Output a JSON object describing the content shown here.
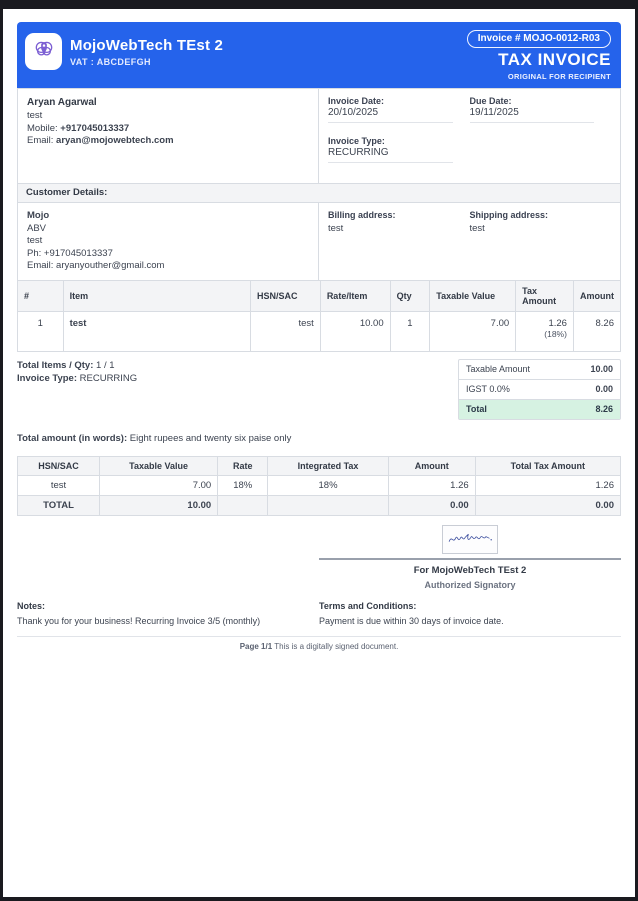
{
  "header": {
    "company_name": "MojoWebTech TEst 2",
    "vat_line": "VAT : ABCDEFGH",
    "invoice_number_badge": "Invoice # MOJO-0012-R03",
    "doc_title": "TAX INVOICE",
    "doc_subtitle": "ORIGINAL FOR RECIPIENT",
    "accent_color": "#2563eb",
    "logo_icon": "brain-icon"
  },
  "seller": {
    "name": "Aryan Agarwal",
    "line2": "test",
    "mobile_label": "Mobile: ",
    "mobile_value": "+917045013337",
    "email_label": "Email: ",
    "email_value": "aryan@mojowebtech.com"
  },
  "invoice_meta": {
    "invoice_date_label": "Invoice Date:",
    "invoice_date": "20/10/2025",
    "due_date_label": "Due Date:",
    "due_date": "19/11/2025",
    "invoice_type_label": "Invoice Type:",
    "invoice_type": "RECURRING"
  },
  "customer": {
    "section_title": "Customer Details:",
    "name": "Mojo",
    "line2": "ABV",
    "line3": "test",
    "phone_line": "Ph: +917045013337",
    "email_line": "Email: aryanyouther@gmail.com",
    "billing_label": "Billing address:",
    "billing_value": "test",
    "shipping_label": "Shipping address:",
    "shipping_value": "test"
  },
  "items_table": {
    "headers": [
      "#",
      "Item",
      "HSN/SAC",
      "Rate/Item",
      "Qty",
      "Taxable Value",
      "Tax Amount",
      "Amount"
    ],
    "rows": [
      {
        "sno": "1",
        "item": "test",
        "hsn": "test",
        "rate": "10.00",
        "qty": "1",
        "taxable_value": "7.00",
        "tax_amount": "1.26",
        "tax_rate_note": "(18%)",
        "amount": "8.26"
      }
    ]
  },
  "totals": {
    "items_qty_label": "Total Items / Qty: ",
    "items_qty_value": "1 / 1",
    "invoice_type_label": "Invoice Type: ",
    "invoice_type_value": "RECURRING",
    "rows": [
      {
        "label": "Taxable Amount",
        "value": "10.00"
      },
      {
        "label": "IGST 0.0%",
        "value": "0.00"
      }
    ],
    "total_label": "Total",
    "total_value": "8.26",
    "total_row_bg": "#d6f2e2",
    "words_label": "Total amount (in words): ",
    "words_value": "Eight rupees and twenty six paise only"
  },
  "tax_table": {
    "headers": [
      "HSN/SAC",
      "Taxable Value",
      "Rate",
      "Integrated Tax",
      "Amount",
      "Total Tax Amount"
    ],
    "rows": [
      {
        "hsn": "test",
        "taxable_value": "7.00",
        "rate": "18%",
        "integrated_tax": "18%",
        "amount": "1.26",
        "total_tax": "1.26"
      }
    ],
    "total_row": {
      "label": "TOTAL",
      "taxable_value": "10.00",
      "rate": "",
      "integrated_tax": "",
      "amount": "0.00",
      "total_tax": "0.00"
    }
  },
  "signature": {
    "image": "handwritten-signature",
    "for_line": "For MojoWebTech TEst 2",
    "authorized_line": "Authorized Signatory"
  },
  "notes": {
    "label": "Notes:",
    "text": "Thank you for your business! Recurring Invoice 3/5 (monthly)"
  },
  "terms": {
    "label": "Terms and Conditions:",
    "text": "Payment is due within 30 days of invoice date."
  },
  "footer": {
    "page_label": "Page 1/1",
    "text": " This is a digitally signed document."
  }
}
